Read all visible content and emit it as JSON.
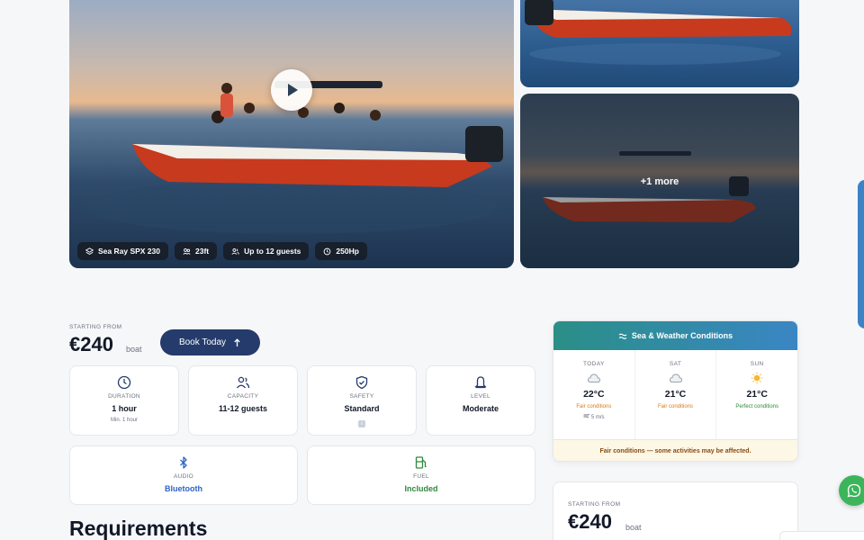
{
  "gallery": {
    "more_label": "+1 more",
    "chips": [
      {
        "icon": "layers-icon",
        "label": "Sea Ray SPX 230"
      },
      {
        "icon": "ruler-icon",
        "label": "23ft"
      },
      {
        "icon": "users-icon",
        "label": "Up to 12 guests"
      },
      {
        "icon": "gauge-icon",
        "label": "250Hp"
      }
    ]
  },
  "booking": {
    "starting_from": "STARTING FROM",
    "price": "€240",
    "unit": "boat",
    "book_label": "Book Today"
  },
  "specs": [
    {
      "icon": "clock-icon",
      "label": "DURATION",
      "value": "1 hour",
      "sub": "Min. 1 hour"
    },
    {
      "icon": "users-icon",
      "label": "CAPACITY",
      "value": "11-12 guests"
    },
    {
      "icon": "shield-check-icon",
      "label": "SAFETY",
      "value": "Standard",
      "badge": "i"
    },
    {
      "icon": "bell-icon",
      "label": "LEVEL",
      "value": "Moderate"
    },
    {
      "icon": "bluetooth-icon",
      "label": "AUDIO",
      "value": "Bluetooth"
    },
    {
      "icon": "fuel-icon",
      "label": "FUEL",
      "value": "Included"
    }
  ],
  "requirements_title": "Requirements",
  "weather": {
    "title": "Sea & Weather Conditions",
    "days": [
      {
        "name": "TODAY",
        "icon": "cloud-icon",
        "temp": "22°C",
        "condition": "Fair conditions",
        "wind": "5 m/s"
      },
      {
        "name": "SAT",
        "icon": "cloud-icon",
        "temp": "21°C",
        "condition": "Fair conditions"
      },
      {
        "name": "SUN",
        "icon": "sun-icon",
        "temp": "21°C",
        "condition": "Perfect conditions"
      }
    ],
    "footer": "Fair conditions — some activities may be affected."
  },
  "sidebar_price": {
    "starting_from": "STARTING FROM",
    "price": "€240",
    "unit": "boat"
  },
  "colors": {
    "primary": "#243b6b",
    "accent_blue": "#2d63c8",
    "accent_green": "#2f8a3c",
    "fair_orange": "#d97a1a",
    "perfect_green": "#2f8a3c"
  }
}
